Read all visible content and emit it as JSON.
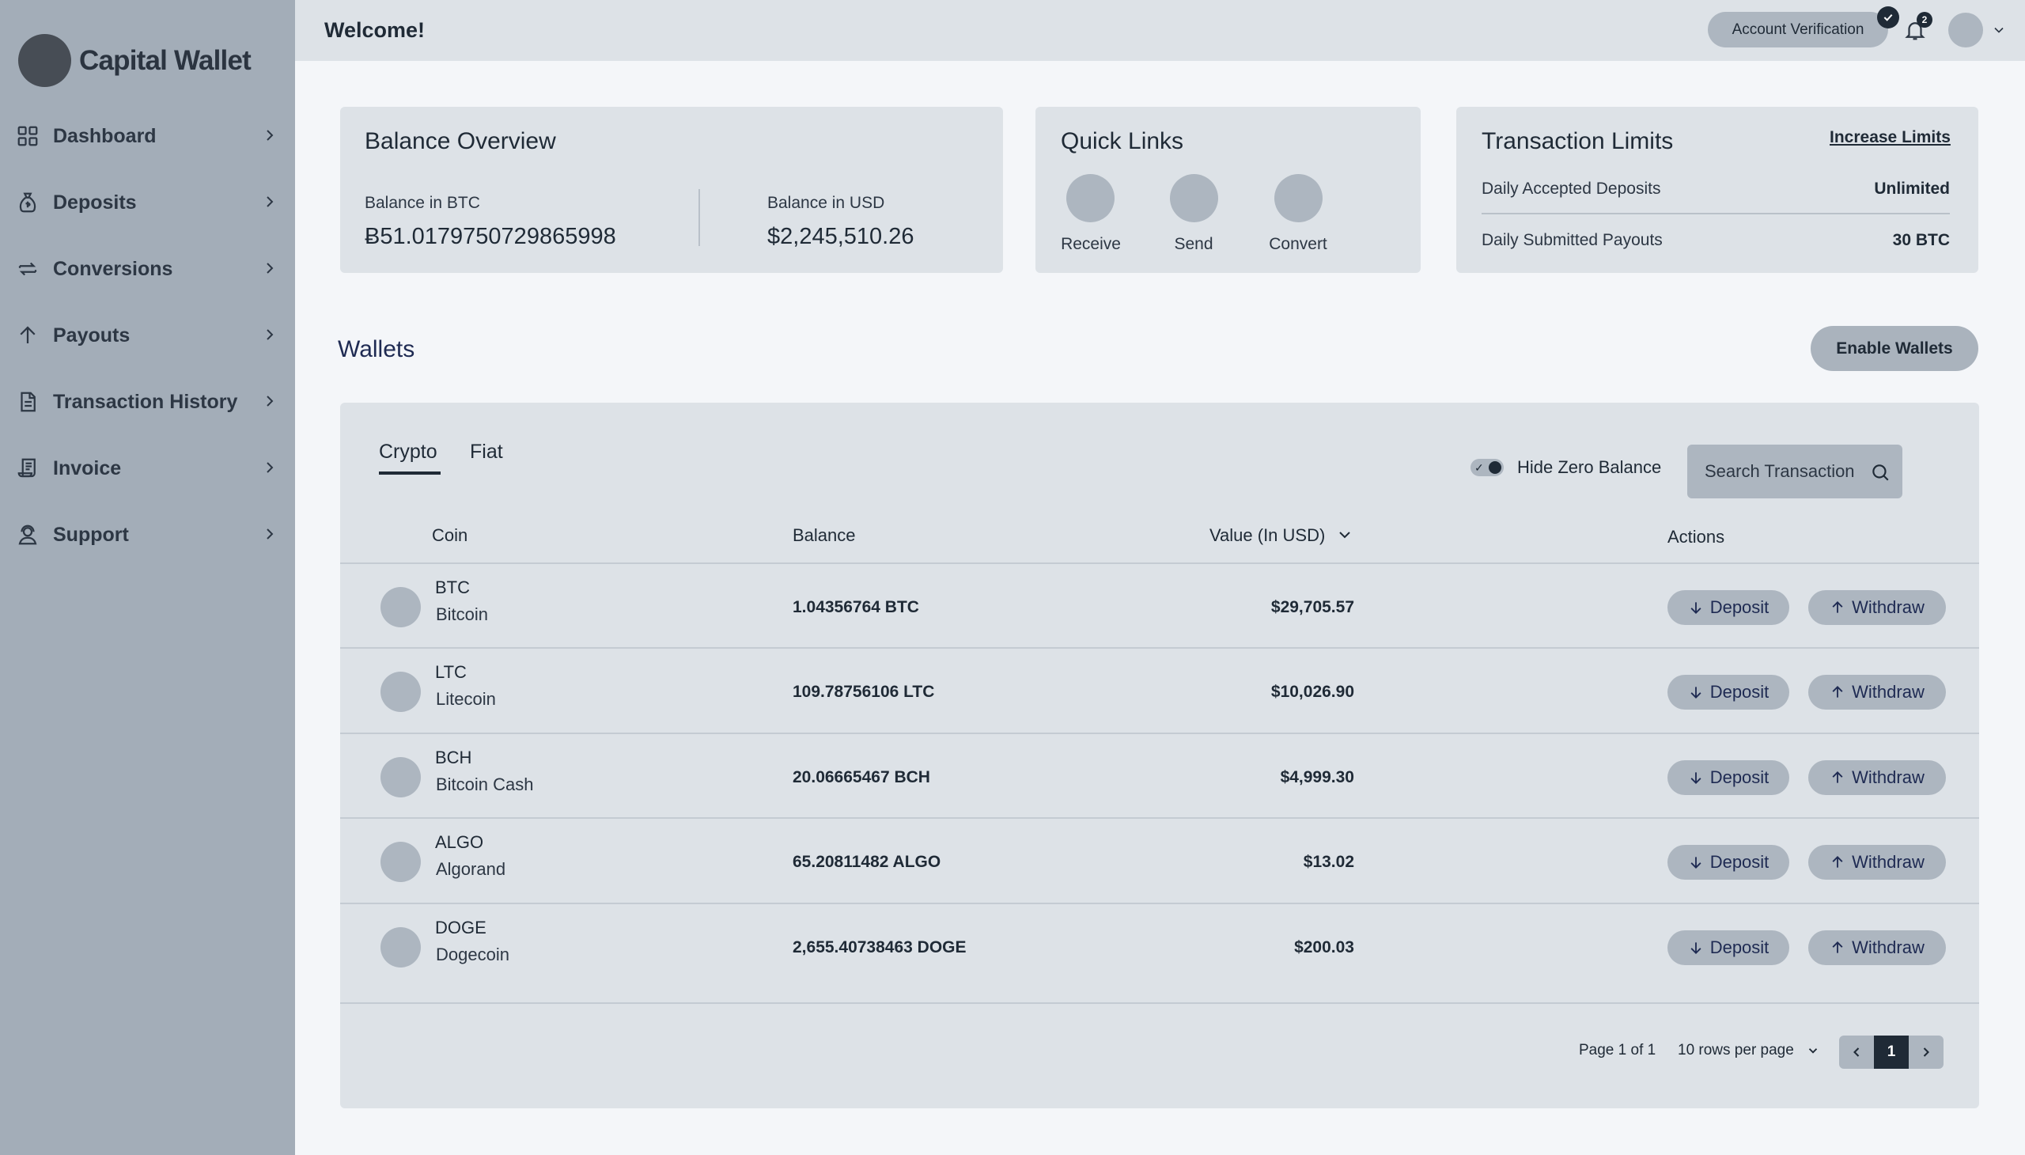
{
  "brand": {
    "name": "Capital Wallet"
  },
  "sidebar": {
    "items": [
      {
        "label": "Dashboard",
        "icon": "grid-icon"
      },
      {
        "label": "Deposits",
        "icon": "money-bag-icon"
      },
      {
        "label": "Conversions",
        "icon": "convert-arrows-icon"
      },
      {
        "label": "Payouts",
        "icon": "arrow-up-icon"
      },
      {
        "label": "Transaction History",
        "icon": "document-icon"
      },
      {
        "label": "Invoice",
        "icon": "invoice-icon"
      },
      {
        "label": "Support",
        "icon": "support-agent-icon"
      }
    ]
  },
  "header": {
    "welcome": "Welcome!",
    "account_verification": "Account Verification",
    "notification_count": "2"
  },
  "balance_overview": {
    "title": "Balance Overview",
    "btc_label": "Balance in BTC",
    "btc_value": "Ƀ51.0179750729865998",
    "usd_label": "Balance in USD",
    "usd_value": "$2,245,510.26"
  },
  "quick_links": {
    "title": "Quick Links",
    "items": [
      {
        "label": "Receive"
      },
      {
        "label": "Send"
      },
      {
        "label": "Convert"
      }
    ]
  },
  "transaction_limits": {
    "title": "Transaction Limits",
    "link": "Increase Limits",
    "rows": [
      {
        "label": "Daily Accepted Deposits",
        "value": "Unlimited"
      },
      {
        "label": "Daily Submitted Payouts",
        "value": "30 BTC"
      }
    ]
  },
  "wallets": {
    "title": "Wallets",
    "enable_button": "Enable Wallets",
    "tabs": [
      {
        "label": "Crypto"
      },
      {
        "label": "Fiat"
      }
    ],
    "hide_zero_label": "Hide Zero Balance",
    "hide_zero_checked": true,
    "search_placeholder": "Search Transaction",
    "columns": {
      "coin": "Coin",
      "balance": "Balance",
      "value": "Value (In USD)",
      "actions": "Actions"
    },
    "deposit_label": "Deposit",
    "withdraw_label": "Withdraw",
    "rows": [
      {
        "symbol": "BTC",
        "name": "Bitcoin",
        "balance": "1.04356764 BTC",
        "value": "$29,705.57"
      },
      {
        "symbol": "LTC",
        "name": "Litecoin",
        "balance": "109.78756106 LTC",
        "value": "$10,026.90"
      },
      {
        "symbol": "BCH",
        "name": "Bitcoin Cash",
        "balance": "20.06665467 BCH",
        "value": "$4,999.30"
      },
      {
        "symbol": "ALGO",
        "name": "Algorand",
        "balance": "65.20811482 ALGO",
        "value": "$13.02"
      },
      {
        "symbol": "DOGE",
        "name": "Dogecoin",
        "balance": "2,655.40738463 DOGE",
        "value": "$200.03"
      }
    ],
    "pagination": {
      "page_text": "Page 1 of 1",
      "rows_per_page": "10 rows per page",
      "current_page": "1"
    }
  },
  "colors": {
    "sidebar": "#a3adb8",
    "card": "#dde2e7",
    "accent": "#1f2a36",
    "title_blue": "#1e2a52"
  }
}
